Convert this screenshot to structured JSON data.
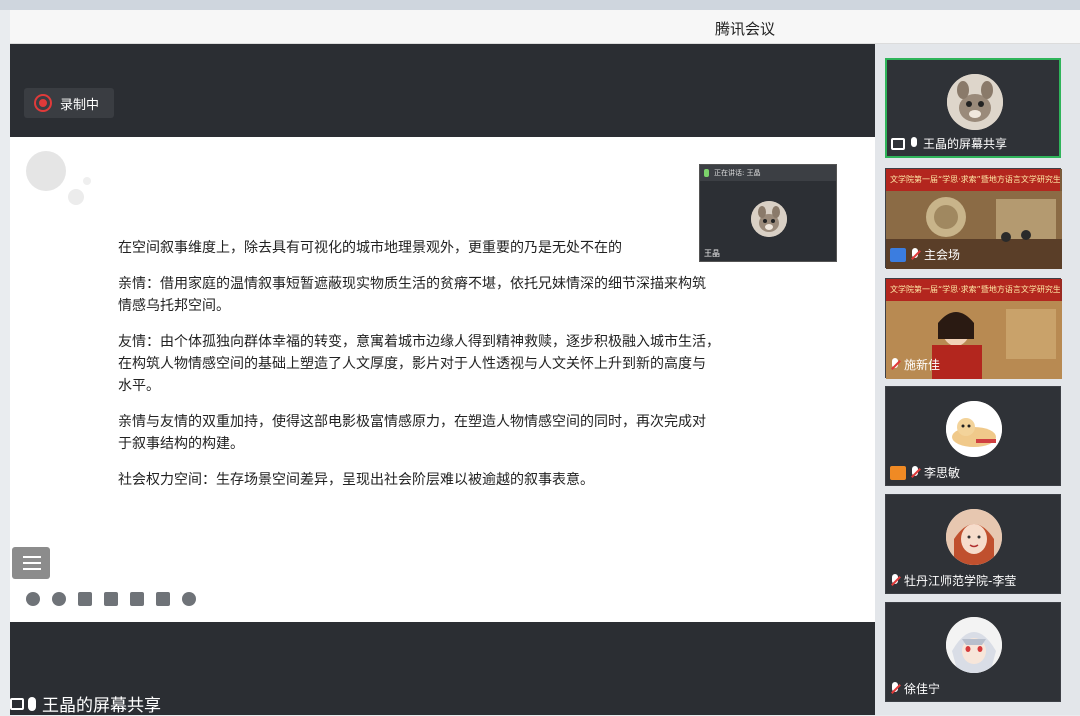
{
  "window": {
    "title": "腾讯会议"
  },
  "recording": {
    "label": "录制中",
    "color": "#e03a3a"
  },
  "slide": {
    "paragraphs": [
      "在空间叙事维度上，除去具有可视化的城市地理景观外，更重要的乃是无处不在的",
      "亲情：借用家庭的温情叙事短暂遮蔽现实物质生活的贫瘠不堪，依托兄妹情深的细节深描来构筑\n情感乌托邦空间。",
      "友情：由个体孤独向群体幸福的转变，意寓着城市边缘人得到精神救赎，逐步积极融入城市生活，\n在构筑人物情感空间的基础上塑造了人文厚度，影片对于人性透视与人文关怀上升到新的高度与\n水平。",
      "亲情与友情的双重加持，使得这部电影极富情感原力，在塑造人物情感空间的同时，再次完成对\n于叙事结构的构建。",
      "社会权力空间：生存场景空间差异，呈现出社会阶层难以被逾越的叙事表意。"
    ]
  },
  "pip": {
    "speaking_label": "正在讲话: 王晶",
    "name": "王晶"
  },
  "toolbar": {
    "icons": [
      "prev-icon",
      "next-icon",
      "pen-icon",
      "screenshot-icon",
      "camera-icon",
      "comment-icon",
      "more-icon"
    ]
  },
  "bottom_bar": {
    "label": "王晶的屏幕共享"
  },
  "participants": [
    {
      "name": "王晶的屏幕共享",
      "active": true,
      "icon": "screen-share-icon",
      "mic": "on"
    },
    {
      "name": "主会场",
      "active": false,
      "icon": "user-icon",
      "mic": "off",
      "banner": "文学院第一届“学思·求索”暨地方语言文学研究生学术论坛"
    },
    {
      "name": "施新佳",
      "active": false,
      "icon": "none",
      "mic": "off",
      "banner": "文学院第一届“学思·求索”暨地方语言文学研究生"
    },
    {
      "name": "李思敏",
      "active": false,
      "icon": "user-icon",
      "mic": "off"
    },
    {
      "name": "牡丹江师范学院-李莹",
      "active": false,
      "icon": "none",
      "mic": "off"
    },
    {
      "name": "徐佳宁",
      "active": false,
      "icon": "none",
      "mic": "off"
    }
  ],
  "colors": {
    "accent": "#2fb45a",
    "user_badge_blue": "#3b7de0",
    "user_badge_orange": "#f08a24"
  }
}
